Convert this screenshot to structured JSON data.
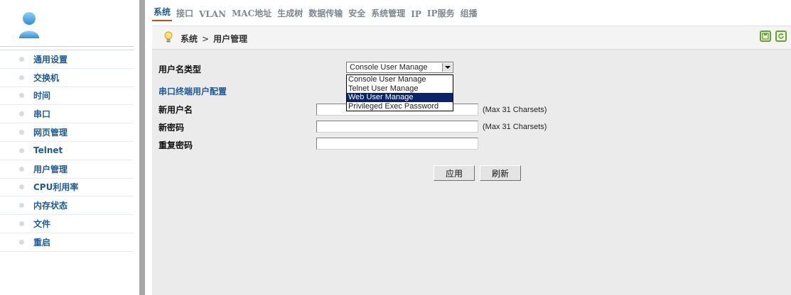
{
  "tabs": [
    "系统",
    "接口",
    "VLAN",
    "MAC地址",
    "生成树",
    "数据传输",
    "安全",
    "系统管理",
    "IP",
    "IP服务",
    "组播"
  ],
  "breadcrumb": {
    "root": "系统",
    "separator": ">",
    "current": "用户管理"
  },
  "sidebar": {
    "items": [
      "通用设置",
      "交换机",
      "时间",
      "串口",
      "网页管理",
      "Telnet",
      "用户管理",
      "CPU利用率",
      "内存状态",
      "文件",
      "重启"
    ]
  },
  "form": {
    "username_type_label": "用户名类型",
    "username_type_selected": "Console User Manage",
    "username_type_options": [
      "Console User Manage",
      "Telnet User Manage",
      "Web User Manage",
      "Privileged Exec Password"
    ],
    "highlighted_option": "Web User Manage",
    "section_title": "串口终端用户配置",
    "new_username_label": "新用户名",
    "new_password_label": "新密码",
    "repeat_password_label": "重复密码",
    "new_username_hint": "(Max 31 Charsets)",
    "new_password_hint": "(Max 31 Charsets)",
    "apply_label": "应用",
    "refresh_label": "刷新"
  },
  "colors": {
    "accent": "#1d5b96",
    "active_tab_underline": "#c64c16",
    "tool_icon": "#66a032"
  }
}
